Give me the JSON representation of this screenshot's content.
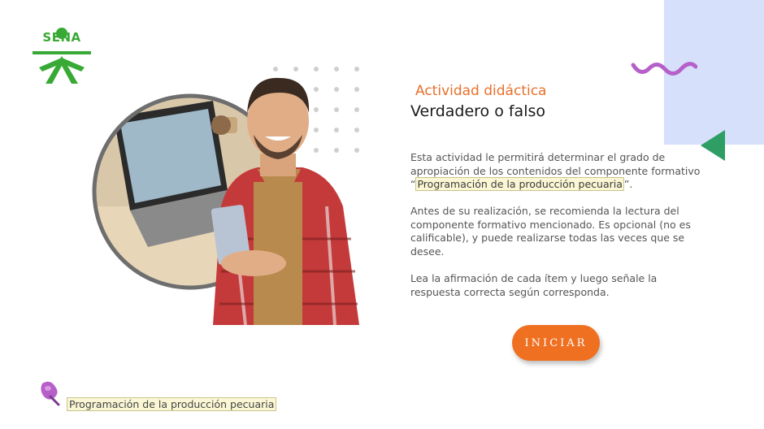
{
  "brand": {
    "logo_text": "SENA"
  },
  "content": {
    "subtitle": "Actividad didáctica",
    "title": "Verdadero o falso",
    "p1_text": "Esta actividad le permitirá determinar el grado de apropiación de los contenidos del componente formativo “",
    "p1_highlight": "Programación de la producción pecuaria",
    "p1_end": "”.",
    "p2_text": "Antes de su realización, se recomienda la lectura del componente formativo mencionado.  Es opcional (no es calificable), y puede realizarse todas las veces que se desee.",
    "p3_text": "Lea la afirmación de cada ítem y luego señale la respuesta correcta según corresponda."
  },
  "actions": {
    "start_label": "INICIAR"
  },
  "footer": {
    "course_label": "Programación de la producción pecuaria"
  },
  "icons": {
    "logo": "sena-logo-icon",
    "decor_wave": "wave-icon",
    "back": "triangle-left-icon",
    "footer": "pin-icon"
  },
  "colors": {
    "accent_orange": "#f07022",
    "brand_green": "#39a935",
    "panel_blue": "#d6e0fb",
    "wave_purple": "#b65fc9",
    "arrow_green": "#2e9e64"
  }
}
